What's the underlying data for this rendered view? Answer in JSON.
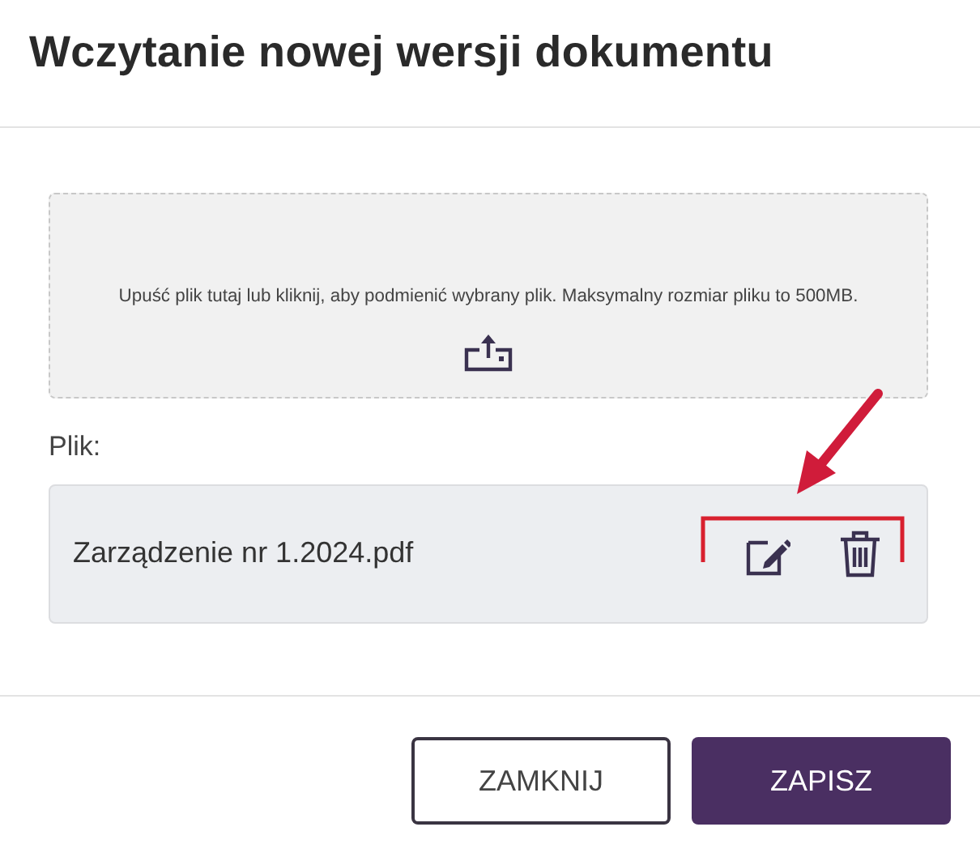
{
  "dialog": {
    "title": "Wczytanie nowej wersji dokumentu"
  },
  "dropzone": {
    "text": "Upuść plik tutaj lub kliknij, aby podmienić wybrany plik. Maksymalny rozmiar pliku to 500MB."
  },
  "file_label": "Plik:",
  "file": {
    "name": "Zarządzenie nr 1.2024.pdf"
  },
  "buttons": [
    {
      "label": "ZAMKNIJ",
      "kind": "secondary"
    },
    {
      "label": "ZAPISZ",
      "kind": "primary"
    }
  ]
}
